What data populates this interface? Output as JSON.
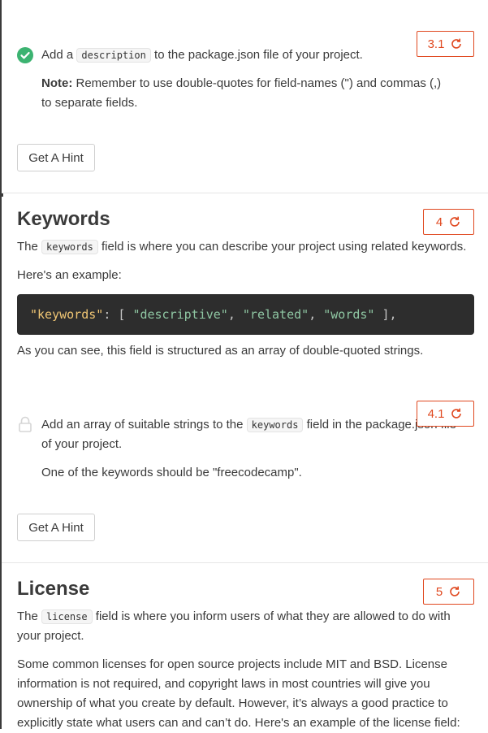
{
  "step31": {
    "badge": "3.1",
    "pre": "Add a",
    "code": "description",
    "post": "to the package.json file of your project.",
    "note_label": "Note:",
    "note_text": "Remember to use double-quotes for field-names (\") and commas (,) to separate fields.",
    "hint": "Get A Hint"
  },
  "keywords_section": {
    "title": "Keywords",
    "badge": "4",
    "intro_pre": "The",
    "intro_code": "keywords",
    "intro_post": "field is where you can describe your project using related keywords.",
    "example_label": "Here's an example:",
    "code_key": "\"keywords\"",
    "code_colon": ": [ ",
    "code_s1": "\"descriptive\"",
    "code_c1": ", ",
    "code_s2": "\"related\"",
    "code_c2": ", ",
    "code_s3": "\"words\"",
    "code_end": " ],",
    "after_code": "As you can see, this field is structured as an array of double-quoted strings."
  },
  "step41": {
    "badge": "4.1",
    "pre": "Add an array of suitable strings to the",
    "code": "keywords",
    "post": "field in the package.json file of your project.",
    "line2": "One of the keywords should be \"freecodecamp\".",
    "hint": "Get A Hint"
  },
  "license_section": {
    "title": "License",
    "badge": "5",
    "intro_pre": "The",
    "intro_code": "license",
    "intro_post": "field is where you inform users of what they are allowed to do with your project.",
    "para": "Some common licenses for open source projects include MIT and BSD. License information is not required, and copyright laws in most countries will give you ownership of what you create by default. However, it’s always a good practice to explicitly state what users can and can’t do. Here's an example of the license field:"
  },
  "colors": {
    "accent": "#e0481f",
    "success": "#3cb371",
    "codeblock_bg": "#2d2d2d"
  }
}
